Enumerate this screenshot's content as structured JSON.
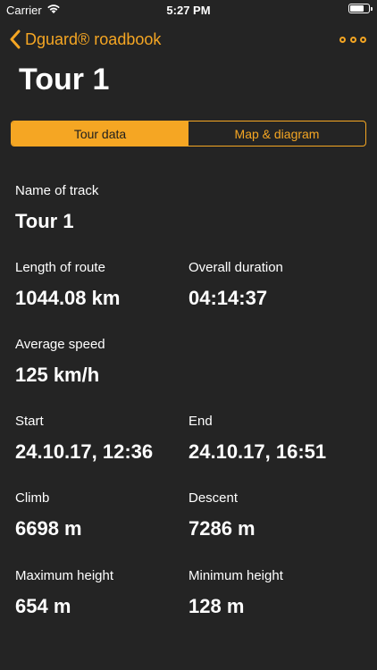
{
  "status_bar": {
    "carrier": "Carrier",
    "time": "5:27 PM",
    "battery_level": 0.8
  },
  "nav": {
    "back_label": "Dguard® roadbook",
    "accent_color": "#F5A623"
  },
  "page_title": "Tour 1",
  "tabs": [
    {
      "label": "Tour data",
      "selected": true
    },
    {
      "label": "Map & diagram",
      "selected": false
    }
  ],
  "fields": {
    "name": {
      "label": "Name of track",
      "value": "Tour 1"
    },
    "length": {
      "label": "Length of route",
      "value": "1044.08 km"
    },
    "duration": {
      "label": "Overall duration",
      "value": "04:14:37"
    },
    "avg_speed": {
      "label": "Average speed",
      "value": "125 km/h"
    },
    "start": {
      "label": "Start",
      "value": "24.10.17, 12:36"
    },
    "end": {
      "label": "End",
      "value": "24.10.17, 16:51"
    },
    "climb": {
      "label": "Climb",
      "value": "6698 m"
    },
    "descent": {
      "label": "Descent",
      "value": "7286 m"
    },
    "max_height": {
      "label": "Maximum height",
      "value": "654 m"
    },
    "min_height": {
      "label": "Minimum height",
      "value": "128 m"
    }
  }
}
